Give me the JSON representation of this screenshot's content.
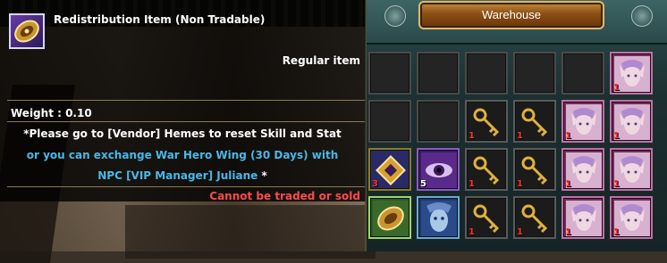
{
  "warehouse": {
    "title": "Warehouse",
    "slots": [
      {
        "item": "empty"
      },
      {
        "item": "empty"
      },
      {
        "item": "empty"
      },
      {
        "item": "empty"
      },
      {
        "item": "empty"
      },
      {
        "item": "elf-portrait",
        "qty": "1"
      },
      {
        "item": "empty"
      },
      {
        "item": "empty"
      },
      {
        "item": "golden-key",
        "qty": "1"
      },
      {
        "item": "golden-key",
        "qty": "1"
      },
      {
        "item": "elf-portrait",
        "qty": "1"
      },
      {
        "item": "elf-portrait",
        "qty": "1"
      },
      {
        "item": "golden-pendant",
        "qty": "3"
      },
      {
        "item": "eye-portrait",
        "qty": "5"
      },
      {
        "item": "golden-key",
        "qty": "1"
      },
      {
        "item": "golden-key",
        "qty": "1"
      },
      {
        "item": "elf-portrait",
        "qty": "1"
      },
      {
        "item": "elf-portrait",
        "qty": "1"
      },
      {
        "item": "redistribution-coin",
        "qty": ""
      },
      {
        "item": "blue-face-portrait",
        "qty": ""
      },
      {
        "item": "golden-key",
        "qty": "1"
      },
      {
        "item": "golden-key",
        "qty": "1"
      },
      {
        "item": "elf-portrait",
        "qty": "1"
      },
      {
        "item": "elf-portrait",
        "qty": "1"
      }
    ]
  },
  "tooltip": {
    "title": "Redistribution Item (Non Tradable)",
    "grade": "Regular item",
    "weight": "Weight : 0.10",
    "description_line1": "*Please go to [Vendor] Hemes to reset Skill and Stat",
    "description_line2": "or you can exchange War Hero Wing (30 Days) with",
    "description_line3": "NPC [VIP Manager] Juliane",
    "description_line3_suffix": " *",
    "trade_status": "Cannot be traded or sold",
    "icon": "redistribution-coin-icon"
  },
  "colors": {
    "title_text": "#ffffff",
    "highlight_text": "#49b8e8",
    "warning_text": "#ff4a4a",
    "quantity_red": "#ff3030",
    "warehouse_button": "#8a4f16"
  }
}
